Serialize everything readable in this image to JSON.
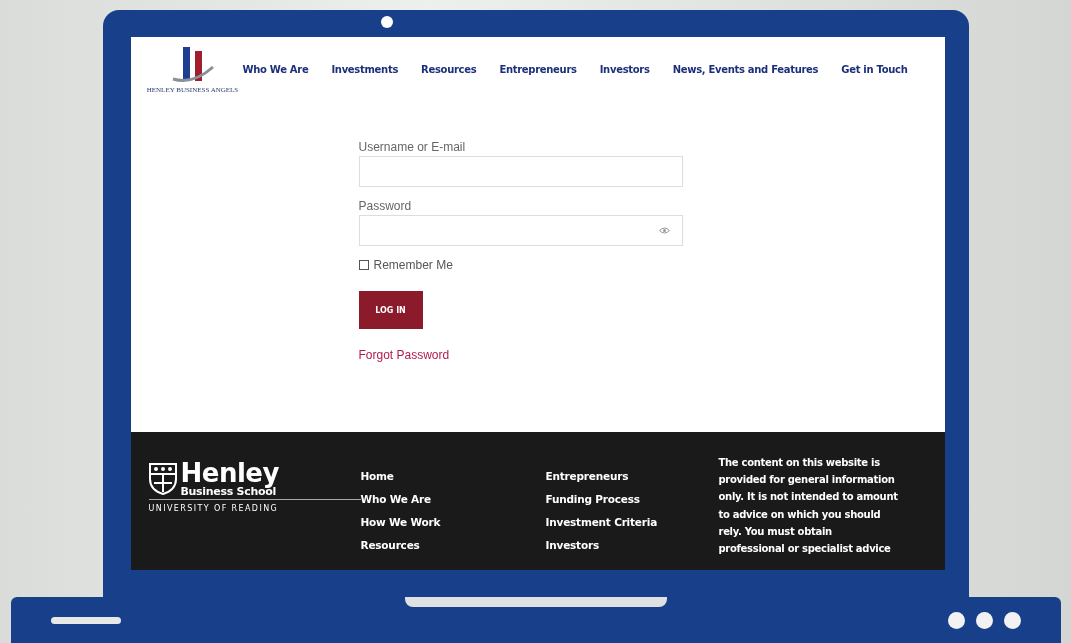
{
  "header": {
    "logo_caption": "HENLEY BUSINESS ANGELS",
    "nav": [
      {
        "label": "Who We Are"
      },
      {
        "label": "Investments"
      },
      {
        "label": "Resources"
      },
      {
        "label": "Entrepreneurs"
      },
      {
        "label": "Investors"
      },
      {
        "label": "News, Events and Features"
      },
      {
        "label": "Get in Touch"
      }
    ]
  },
  "login": {
    "username_label": "Username or E-mail",
    "password_label": "Password",
    "remember": {
      "label": "Remember Me",
      "checked": false
    },
    "button": "LOG IN",
    "forgot": "Forgot Password"
  },
  "footer": {
    "logo": {
      "name": "Henley",
      "subtitle": "Business School",
      "university": "UNIVERSITY OF READING"
    },
    "column_1": [
      "Home",
      "Who We Are",
      "How We Work",
      "Resources"
    ],
    "column_2": [
      "Entrepreneurs",
      "Funding Process",
      "Investment Criteria",
      "Investors"
    ],
    "disclaimer": "The content on this website is provided for general information only. It is not intended to amount to advice on which you should rely. You must obtain professional or specialist advice"
  }
}
